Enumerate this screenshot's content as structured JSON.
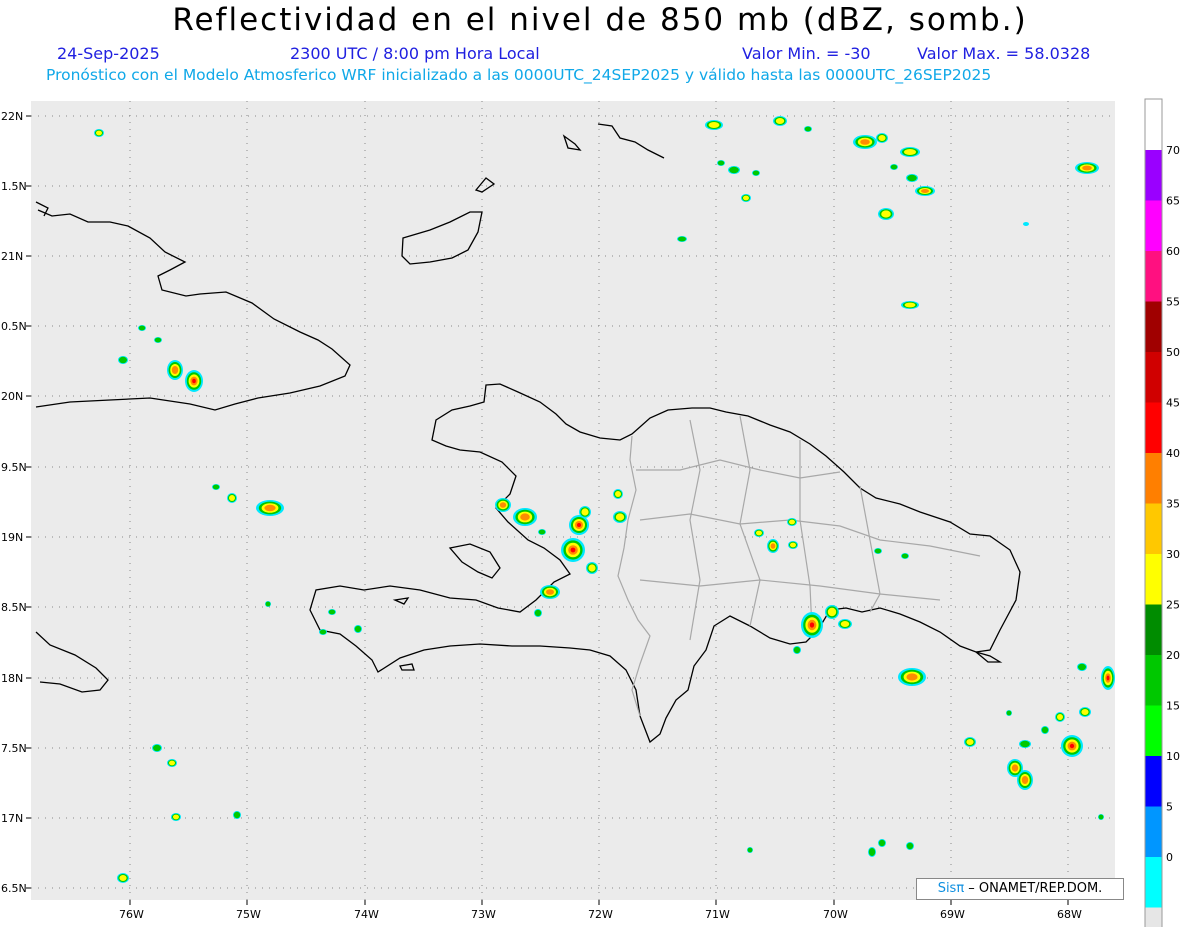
{
  "header": {
    "title": "Reflectividad en el nivel de 850 mb (dBZ, somb.)",
    "date": "24-Sep-2025",
    "time": "2300 UTC / 8:00 pm Hora Local",
    "min_label": "Valor Min. = -30",
    "max_label": "Valor Max. = 58.0328",
    "forecast_line": "Pronóstico con el Modelo Atmosferico WRF inicializado a las 0000UTC_24SEP2025 y válido hasta las  0000UTC_26SEP2025"
  },
  "map": {
    "lat_ticks": [
      "22N",
      "1.5N",
      "21N",
      "0.5N",
      "20N",
      "9.5N",
      "19N",
      "8.5N",
      "18N",
      "7.5N",
      "17N",
      "6.5N"
    ],
    "lon_ticks": [
      "76W",
      "75W",
      "74W",
      "73W",
      "72W",
      "71W",
      "70W",
      "69W",
      "68W"
    ]
  },
  "colorbar": {
    "labels": [
      "70",
      "65",
      "60",
      "55",
      "50",
      "45",
      "40",
      "35",
      "30",
      "25",
      "20",
      "15",
      "10",
      "5",
      "0"
    ],
    "colors": [
      "#ffffff",
      "#9a00ff",
      "#ff00ff",
      "#ff1080",
      "#a00000",
      "#d00000",
      "#ff0000",
      "#ff7f00",
      "#ffc800",
      "#ffff00",
      "#008c00",
      "#00c800",
      "#00ff00",
      "#0000ff",
      "#0096ff",
      "#00ffff",
      "#e6e6e6"
    ]
  },
  "credit": {
    "logo": "Sisπ",
    "text": " – ONAMET/REP.DOM."
  }
}
